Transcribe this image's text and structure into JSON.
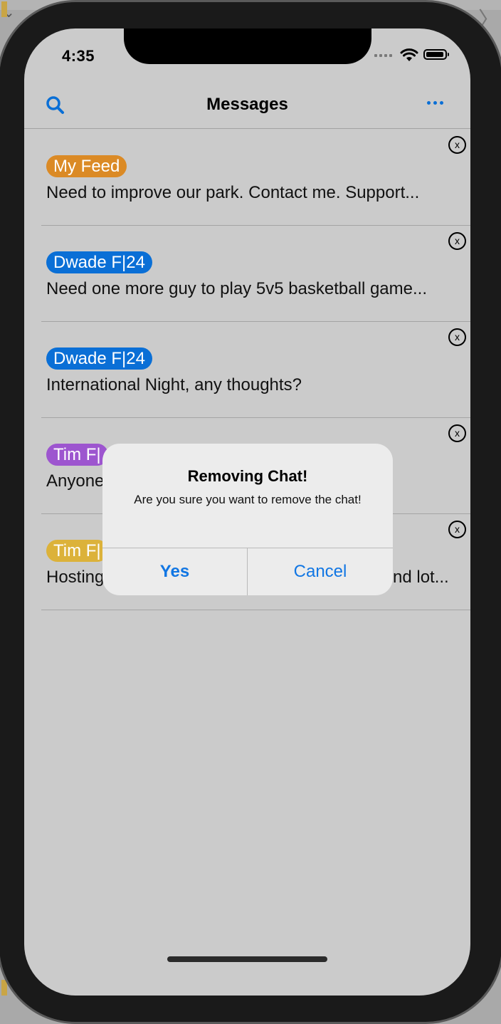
{
  "status_bar": {
    "time": "4:35"
  },
  "navbar": {
    "title": "Messages",
    "search_icon": "search-icon",
    "more_icon": "more-icon"
  },
  "chats": [
    {
      "tag": "My Feed",
      "tag_color": "#db8a25",
      "message": "Need to improve our park. Contact me. Support..."
    },
    {
      "tag": "Dwade F|24",
      "tag_color": "#0a6fd6",
      "message": "Need one more guy to play 5v5 basketball game..."
    },
    {
      "tag": "Dwade F|24",
      "tag_color": "#0a6fd6",
      "message": "International Night, any thoughts?"
    },
    {
      "tag": "Tim F|",
      "tag_color": "#9d55cf",
      "message": "Anyone"
    },
    {
      "tag": "Tim F|",
      "tag_color": "#dcb23a",
      "message": "Hosting",
      "message_tail": "nd lot..."
    }
  ],
  "close_glyph": "x",
  "alert": {
    "title": "Removing Chat!",
    "message": "Are you sure you want to remove the chat!",
    "yes_label": "Yes",
    "cancel_label": "Cancel"
  },
  "colors": {
    "accent": "#1176e3",
    "screen_background": "#cbcbcb",
    "alert_background": "#ececec"
  }
}
